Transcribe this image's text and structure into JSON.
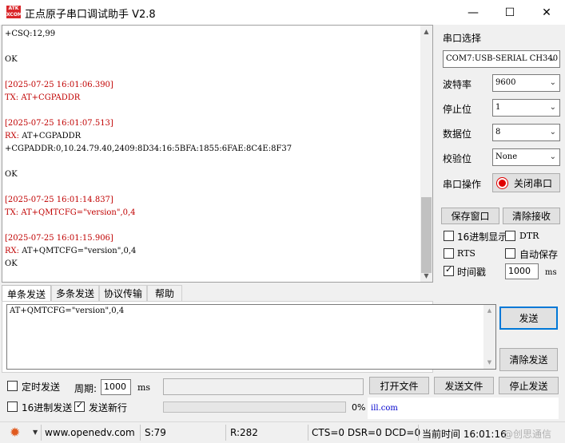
{
  "window": {
    "title": "正点原子串口调试助手 V2.8",
    "logo_top": "ATK",
    "logo_bottom": "XCOM",
    "minimize": "—",
    "maximize": "☐",
    "close": "✕"
  },
  "log": {
    "lines": [
      {
        "text": "+CSQ:12,99",
        "kind": "rx"
      },
      {
        "text": "",
        "kind": "blank"
      },
      {
        "text": "OK",
        "kind": "rx"
      },
      {
        "text": "",
        "kind": "blank"
      },
      {
        "text": "[2025-07-25 16:01:06.390]",
        "kind": "stamp"
      },
      {
        "text": "TX: AT+CGPADDR",
        "kind": "tx"
      },
      {
        "text": "",
        "kind": "blank"
      },
      {
        "text": "[2025-07-25 16:01:07.513]",
        "kind": "stamp"
      },
      {
        "text": "RX: ",
        "tail": "AT+CGPADDR",
        "kind": "rxhead"
      },
      {
        "text": "+CGPADDR:0,10.24.79.40,2409:8D34:16:5BFA:1855:6FAE:8C4E:8F37",
        "kind": "rx"
      },
      {
        "text": "",
        "kind": "blank"
      },
      {
        "text": "OK",
        "kind": "rx"
      },
      {
        "text": "",
        "kind": "blank"
      },
      {
        "text": "[2025-07-25 16:01:14.837]",
        "kind": "stamp"
      },
      {
        "text": "TX: AT+QMTCFG=\"version\",0,4",
        "kind": "tx"
      },
      {
        "text": "",
        "kind": "blank"
      },
      {
        "text": "[2025-07-25 16:01:15.906]",
        "kind": "stamp"
      },
      {
        "text": "RX: ",
        "tail": "AT+QMTCFG=\"version\",0,4",
        "kind": "rxhead"
      },
      {
        "text": "OK",
        "kind": "rx"
      }
    ]
  },
  "settings": {
    "port_label": "串口选择",
    "port_value": "COM7:USB-SERIAL CH340",
    "baud_label": "波特率",
    "baud_value": "9600",
    "stop_label": "停止位",
    "stop_value": "1",
    "data_label": "数据位",
    "data_value": "8",
    "parity_label": "校验位",
    "parity_value": "None",
    "op_label": "串口操作",
    "op_button": "关闭串口",
    "save_window": "保存窗口",
    "clear_recv": "清除接收",
    "hex_display": "16进制显示",
    "dtr": "DTR",
    "rts": "RTS",
    "auto_save": "自动保存",
    "timestamp": "时间戳",
    "timestamp_ms": "1000",
    "ms": "ms"
  },
  "colors": {
    "stamp": "#c00000",
    "accent": "#0078d7",
    "link": "#0000cc"
  },
  "tabs": [
    "单条发送",
    "多条发送",
    "协议传输",
    "帮助"
  ],
  "send": {
    "text": "AT+QMTCFG=\"version\",0,4",
    "send_button": "发送",
    "clear_button": "清除发送",
    "timed_send": "定时发送",
    "period_label": "周期:",
    "period_value": "1000",
    "period_unit": "ms",
    "file_path": "",
    "open_file": "打开文件",
    "send_file": "发送文件",
    "stop_send": "停止发送",
    "hex_send": "16进制发送",
    "send_newline": "发送新行",
    "progress_text": "0%",
    "progress": 0,
    "link_text": "ill.com"
  },
  "status": {
    "url": "www.openedv.com",
    "s": "S:79",
    "r": "R:282",
    "lines": "CTS=0 DSR=0 DCD=0",
    "time": "当前时间 16:01:16",
    "watermark": "@创思通信"
  },
  "icons": {
    "gear": "gear-icon",
    "dropdown": "chevron-down-icon"
  }
}
